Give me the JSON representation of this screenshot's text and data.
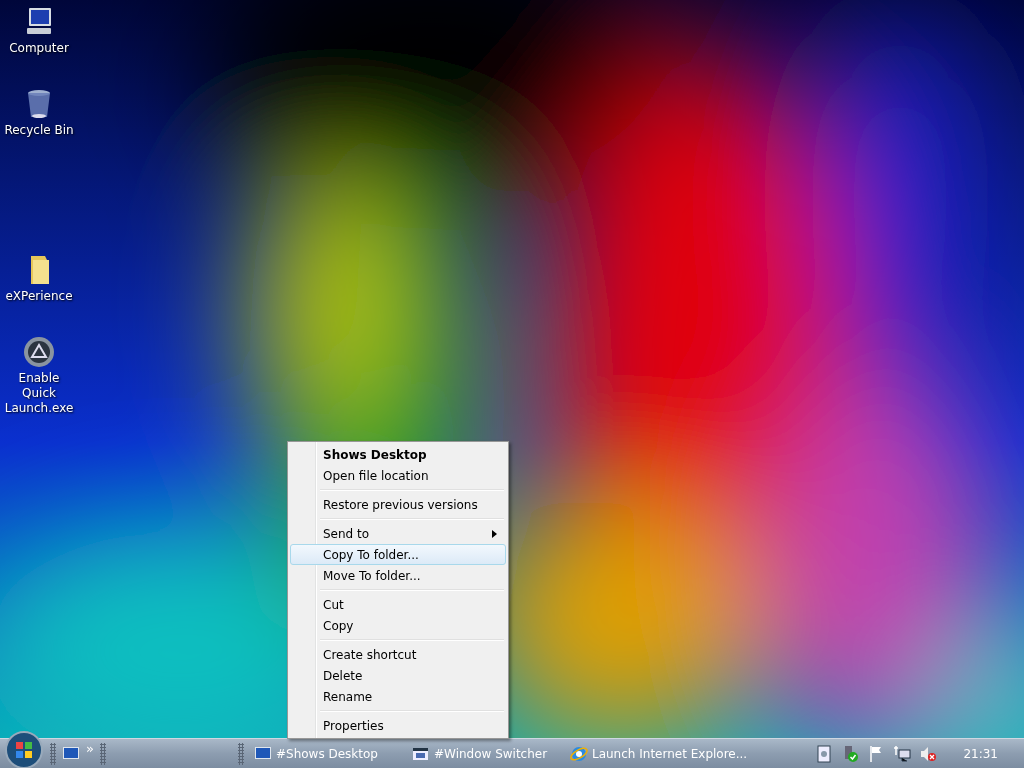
{
  "desktop_icons": [
    {
      "kind": "computer",
      "label": "Computer"
    },
    {
      "kind": "recycle",
      "label": "Recycle Bin"
    },
    {
      "kind": "folder",
      "label": "eXPerience"
    },
    {
      "kind": "app",
      "label": "Enable Quick Launch.exe"
    }
  ],
  "context_menu": {
    "groups": [
      [
        {
          "label": "Shows Desktop",
          "default": true,
          "selected": false,
          "submenu": false
        },
        {
          "label": "Open file location",
          "default": false,
          "selected": false,
          "submenu": false
        }
      ],
      [
        {
          "label": "Restore previous versions",
          "default": false,
          "selected": false,
          "submenu": false
        }
      ],
      [
        {
          "label": "Send to",
          "default": false,
          "selected": false,
          "submenu": true
        },
        {
          "label": "Copy To folder...",
          "default": false,
          "selected": true,
          "submenu": false
        },
        {
          "label": "Move To folder...",
          "default": false,
          "selected": false,
          "submenu": false
        }
      ],
      [
        {
          "label": "Cut",
          "default": false,
          "selected": false,
          "submenu": false
        },
        {
          "label": "Copy",
          "default": false,
          "selected": false,
          "submenu": false
        }
      ],
      [
        {
          "label": "Create shortcut",
          "default": false,
          "selected": false,
          "submenu": false
        },
        {
          "label": "Delete",
          "default": false,
          "selected": false,
          "submenu": false
        },
        {
          "label": "Rename",
          "default": false,
          "selected": false,
          "submenu": false
        }
      ],
      [
        {
          "label": "Properties",
          "default": false,
          "selected": false,
          "submenu": false
        }
      ]
    ]
  },
  "taskbar": {
    "chevron": "»",
    "tasks": [
      {
        "kind": "desktop",
        "label": "#Shows Desktop"
      },
      {
        "kind": "switcher",
        "label": "#Window Switcher"
      },
      {
        "kind": "ie",
        "label": "Launch Internet Explore..."
      }
    ],
    "tray_icons": [
      {
        "kind": "document"
      },
      {
        "kind": "usb"
      },
      {
        "kind": "flag"
      },
      {
        "kind": "network"
      },
      {
        "kind": "volume"
      }
    ],
    "clock": "21:31"
  }
}
